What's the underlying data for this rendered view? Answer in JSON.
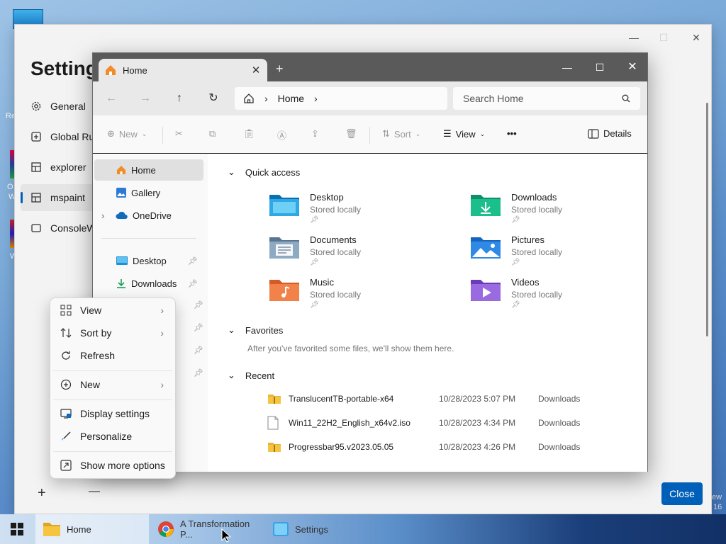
{
  "settings": {
    "title": "Setting",
    "items": [
      {
        "label": "General",
        "icon": "gear-icon"
      },
      {
        "label": "Global Ru",
        "icon": "globe-icon"
      },
      {
        "label": "explorer",
        "icon": "app-icon"
      },
      {
        "label": "mspaint",
        "icon": "app-icon"
      },
      {
        "label": "ConsoleW",
        "icon": "window-icon"
      }
    ],
    "close_label": "Close",
    "add_symbol": "+",
    "remove_symbol": "—"
  },
  "desktop": {
    "frag_re": "Re",
    "frag_o": "O",
    "frag_w": "W",
    "frag_w2": "W",
    "frag_ew": "ew",
    "frag_16": "16"
  },
  "explorer": {
    "tab_label": "Home",
    "new_tab": "+",
    "address_path": "Home",
    "search_placeholder": "Search Home",
    "commands": {
      "new": "New",
      "sort": "Sort",
      "view": "View",
      "details": "Details",
      "more": "•••"
    },
    "nav": {
      "home": "Home",
      "gallery": "Gallery",
      "onedrive": "OneDrive",
      "desktop": "Desktop",
      "downloads": "Downloads"
    },
    "sections": {
      "quick_access": "Quick access",
      "favorites": "Favorites",
      "favorites_empty": "After you've favorited some files, we'll show them here.",
      "recent": "Recent"
    },
    "quick_access": [
      {
        "name": "Desktop",
        "sub": "Stored locally"
      },
      {
        "name": "Downloads",
        "sub": "Stored locally"
      },
      {
        "name": "Documents",
        "sub": "Stored locally"
      },
      {
        "name": "Pictures",
        "sub": "Stored locally"
      },
      {
        "name": "Music",
        "sub": "Stored locally"
      },
      {
        "name": "Videos",
        "sub": "Stored locally"
      }
    ],
    "recent": [
      {
        "name": "TranslucentTB-portable-x64",
        "date": "10/28/2023 5:07 PM",
        "location": "Downloads",
        "icon": "zip-folder-icon"
      },
      {
        "name": "Win11_22H2_English_x64v2.iso",
        "date": "10/28/2023 4:34 PM",
        "location": "Downloads",
        "icon": "file-icon"
      },
      {
        "name": "Progressbar95.v2023.05.05",
        "date": "10/28/2023 4:26 PM",
        "location": "Downloads",
        "icon": "zip-folder-icon"
      }
    ]
  },
  "context_menu": {
    "items": [
      {
        "label": "View",
        "icon": "grid-icon",
        "has_submenu": true
      },
      {
        "label": "Sort by",
        "icon": "sort-icon",
        "has_submenu": true
      },
      {
        "label": "Refresh",
        "icon": "refresh-icon",
        "has_submenu": false
      },
      {
        "label": "New",
        "icon": "plus-circle-icon",
        "has_submenu": true
      },
      {
        "label": "Display settings",
        "icon": "display-icon",
        "has_submenu": false
      },
      {
        "label": "Personalize",
        "icon": "brush-icon",
        "has_submenu": false
      },
      {
        "label": "Show more options",
        "icon": "share-icon",
        "has_submenu": false
      }
    ]
  },
  "taskbar": {
    "items": [
      {
        "label": "Home",
        "icon": "folder-icon"
      },
      {
        "label": "A Transformation P...",
        "icon": "chrome-icon"
      },
      {
        "label": "Settings",
        "icon": "settings-app-icon"
      }
    ]
  },
  "colors": {
    "accent": "#005fb8",
    "folder_yellow": "#f5c542"
  }
}
